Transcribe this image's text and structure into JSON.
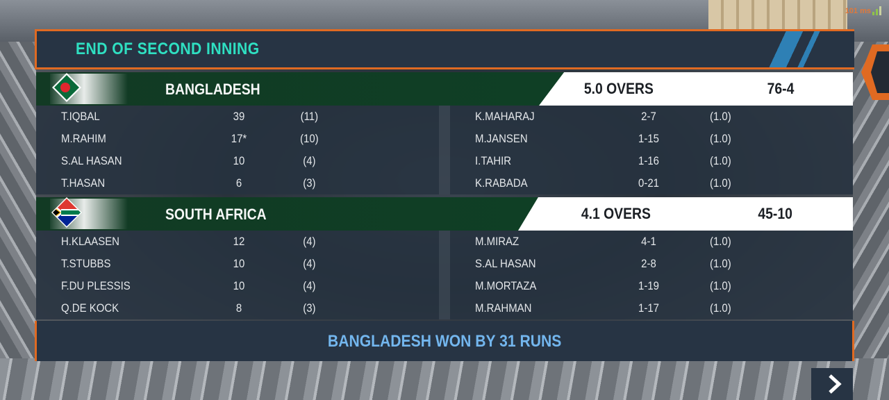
{
  "status": {
    "ping": "101 ms"
  },
  "header": {
    "title": "END OF SECOND INNING"
  },
  "teams": [
    {
      "name": "BANGLADESH",
      "flag": "bangladesh-flag",
      "overs": "5.0 OVERS",
      "score": "76-4",
      "batting": [
        {
          "name": "T.IQBAL",
          "runs": "39",
          "balls": "(11)"
        },
        {
          "name": "M.RAHIM",
          "runs": "17*",
          "balls": "(10)"
        },
        {
          "name": "S.AL HASAN",
          "runs": "10",
          "balls": "(4)"
        },
        {
          "name": "T.HASAN",
          "runs": "6",
          "balls": "(3)"
        }
      ],
      "bowling": [
        {
          "name": "K.MAHARAJ",
          "figures": "2-7",
          "overs": "(1.0)"
        },
        {
          "name": "M.JANSEN",
          "figures": "1-15",
          "overs": "(1.0)"
        },
        {
          "name": "I.TAHIR",
          "figures": "1-16",
          "overs": "(1.0)"
        },
        {
          "name": "K.RABADA",
          "figures": "0-21",
          "overs": "(1.0)"
        }
      ]
    },
    {
      "name": "SOUTH AFRICA",
      "flag": "south-africa-flag",
      "overs": "4.1 OVERS",
      "score": "45-10",
      "batting": [
        {
          "name": "H.KLAASEN",
          "runs": "12",
          "balls": "(4)"
        },
        {
          "name": "T.STUBBS",
          "runs": "10",
          "balls": "(4)"
        },
        {
          "name": "F.DU PLESSIS",
          "runs": "10",
          "balls": "(4)"
        },
        {
          "name": "Q.DE KOCK",
          "runs": "8",
          "balls": "(3)"
        }
      ],
      "bowling": [
        {
          "name": "M.MIRAZ",
          "figures": "4-1",
          "overs": "(1.0)"
        },
        {
          "name": "S.AL HASAN",
          "figures": "2-8",
          "overs": "(1.0)"
        },
        {
          "name": "M.MORTAZA",
          "figures": "1-19",
          "overs": "(1.0)"
        },
        {
          "name": "M.RAHMAN",
          "figures": "1-17",
          "overs": "(1.0)"
        }
      ]
    }
  ],
  "result": {
    "text": "BANGLADESH WON BY 31 RUNS"
  },
  "colors": {
    "accent": "#e06a22",
    "title": "#2fe0c2",
    "result": "#73b6ee",
    "banner": "#123a24"
  }
}
